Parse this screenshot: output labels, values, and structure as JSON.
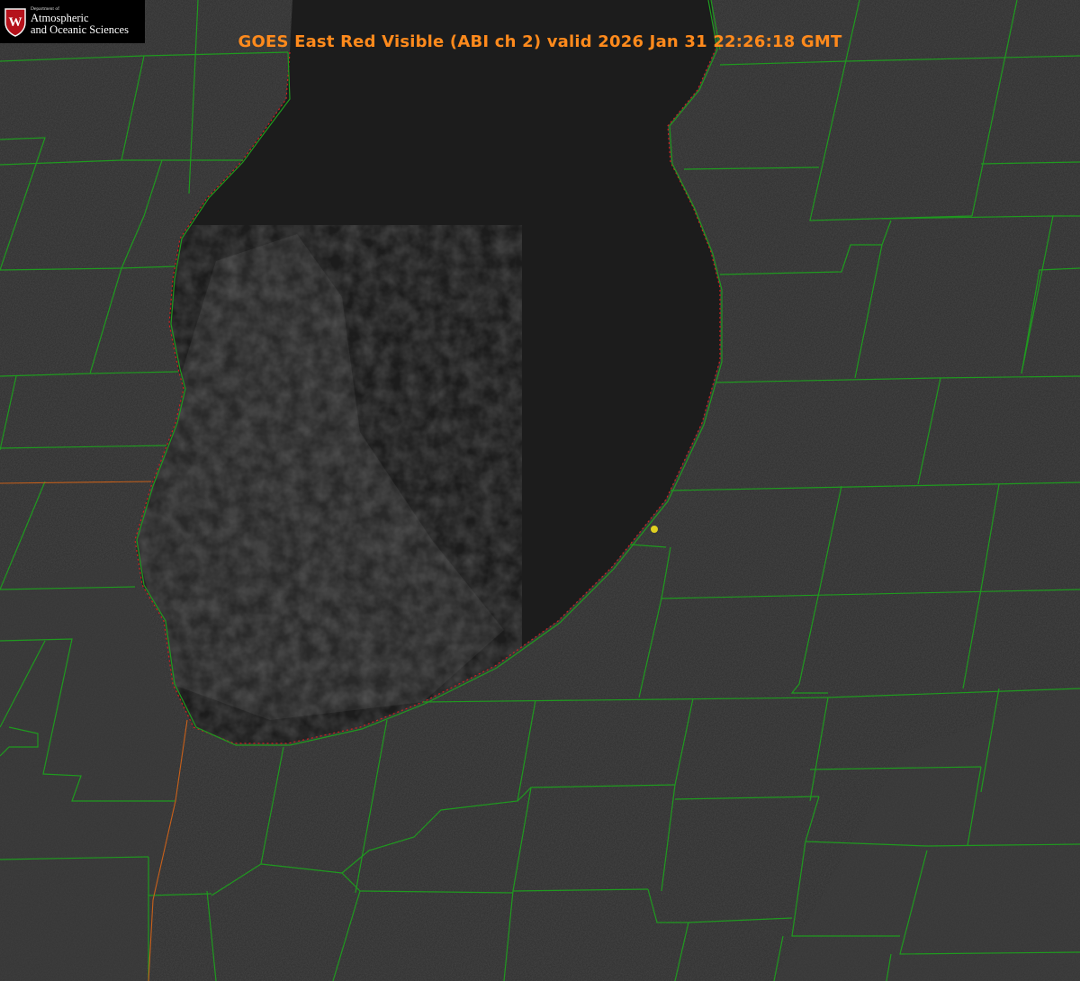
{
  "title": "GOES East Red Visible (ABI ch 2) valid 2026 Jan 31 22:26:18 GMT",
  "logo": {
    "crest_letter": "W",
    "dept_line": "Department of",
    "line1": "Atmospheric",
    "line2": "and Oceanic Sciences"
  },
  "colors": {
    "land": "#2a2a2a",
    "lake": "#1b1b1b",
    "county_lines": "#1f9a1f",
    "state_line": "#c8601a",
    "shoreline_dotted": "#d02020",
    "title": "#ff8a1c",
    "marker": "#e0d020",
    "crest": "#b5121b"
  },
  "icons": {
    "logo_crest": "uw-crest-icon",
    "station_marker": "location-dot-icon"
  }
}
